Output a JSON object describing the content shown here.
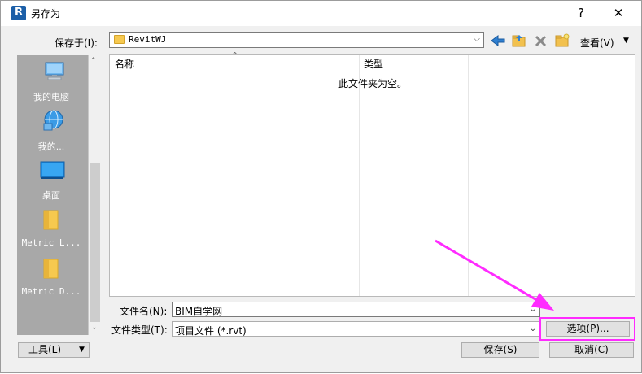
{
  "window": {
    "title": "另存为",
    "help": "?",
    "close": "✕"
  },
  "save_in": {
    "label": "保存于(I):",
    "value": "RevitWJ"
  },
  "toolbar": {
    "view_label": "查看(V)"
  },
  "places": [
    {
      "label": "我的电脑"
    },
    {
      "label": "我的..."
    },
    {
      "label": "桌面"
    },
    {
      "label": "Metric L..."
    },
    {
      "label": "Metric D..."
    }
  ],
  "file_list": {
    "columns": [
      "名称",
      "类型"
    ],
    "empty_message": "此文件夹为空。"
  },
  "filename": {
    "label": "文件名(N):",
    "value": "BIM自学网"
  },
  "filetype": {
    "label": "文件类型(T):",
    "value": "项目文件 (*.rvt)"
  },
  "buttons": {
    "options": "选项(P)...",
    "tools": "工具(L)",
    "save": "保存(S)",
    "cancel": "取消(C)"
  },
  "annotation": {
    "color": "#ff2bff"
  }
}
